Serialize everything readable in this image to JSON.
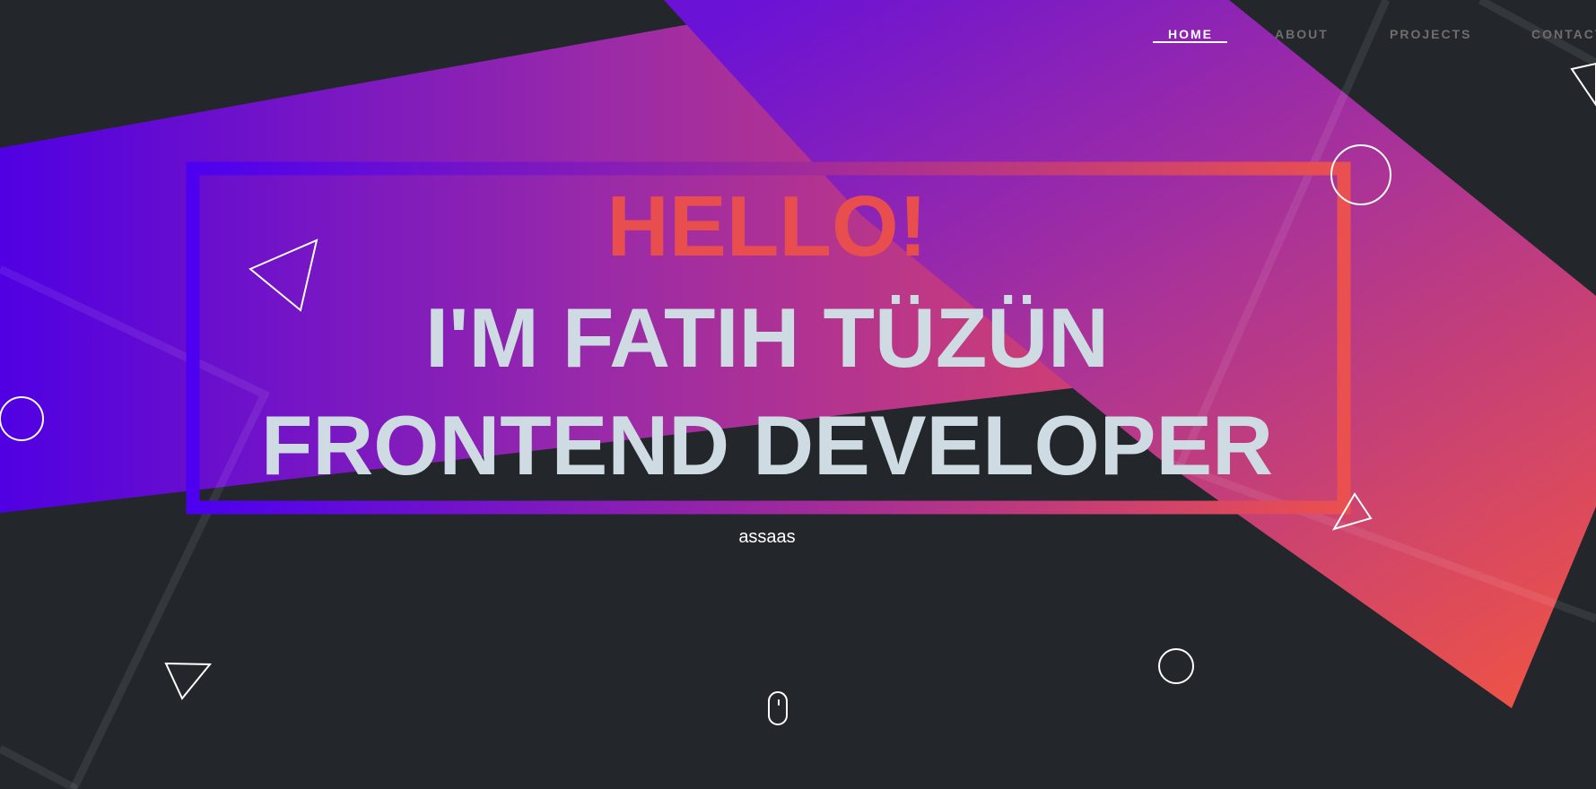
{
  "nav": {
    "items": [
      {
        "label": "HOME",
        "active": true
      },
      {
        "label": "ABOUT",
        "active": false
      },
      {
        "label": "PROJECTS",
        "active": false
      },
      {
        "label": "CONTACT",
        "active": false
      }
    ]
  },
  "hero": {
    "greeting": "HELLO!",
    "name": "I'M FATIH TÜZÜN",
    "role": "FRONTEND DEVELOPER",
    "subtitle": "assaas"
  },
  "colors": {
    "background": "#23272b",
    "gradient_start": "#4b00e0",
    "gradient_end": "#ea5050",
    "greeting": "#e94e4e",
    "heading": "#cfdbe2"
  },
  "icons": [
    "scroll-mouse-icon",
    "triangle-outline-icon",
    "circle-outline-icon"
  ]
}
